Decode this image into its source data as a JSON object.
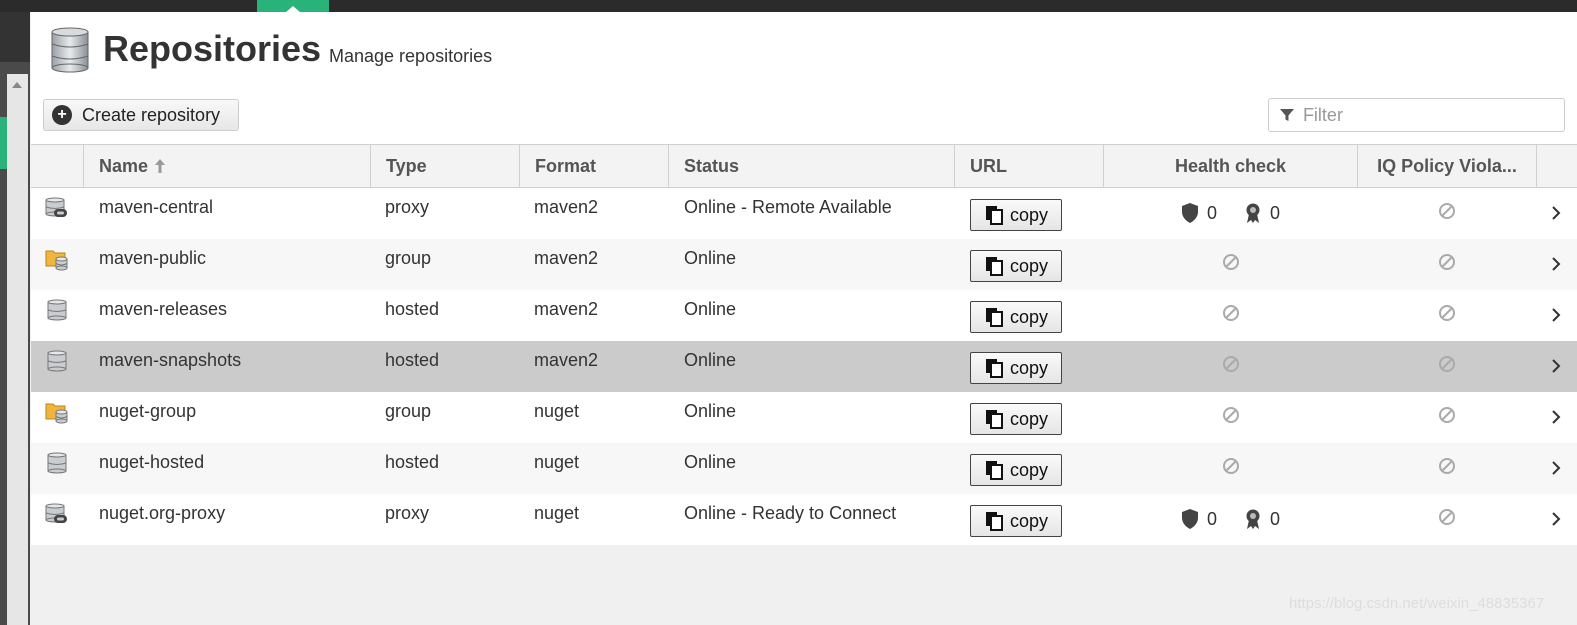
{
  "header": {
    "title": "Repositories",
    "subtitle": "Manage repositories"
  },
  "toolbar": {
    "create_label": "Create repository",
    "filter_placeholder": "Filter"
  },
  "table": {
    "columns": {
      "name": "Name",
      "type": "Type",
      "format": "Format",
      "status": "Status",
      "url": "URL",
      "health": "Health check",
      "iq": "IQ Policy Viola..."
    },
    "copy_label": "copy",
    "rows": [
      {
        "name": "maven-central",
        "type": "proxy",
        "format": "maven2",
        "status": "Online - Remote Available",
        "kind": "proxy",
        "health_security": "0",
        "health_license": "0"
      },
      {
        "name": "maven-public",
        "type": "group",
        "format": "maven2",
        "status": "Online",
        "kind": "group"
      },
      {
        "name": "maven-releases",
        "type": "hosted",
        "format": "maven2",
        "status": "Online",
        "kind": "hosted"
      },
      {
        "name": "maven-snapshots",
        "type": "hosted",
        "format": "maven2",
        "status": "Online",
        "kind": "hosted",
        "selected": true
      },
      {
        "name": "nuget-group",
        "type": "group",
        "format": "nuget",
        "status": "Online",
        "kind": "group"
      },
      {
        "name": "nuget-hosted",
        "type": "hosted",
        "format": "nuget",
        "status": "Online",
        "kind": "hosted"
      },
      {
        "name": "nuget.org-proxy",
        "type": "proxy",
        "format": "nuget",
        "status": "Online - Ready to Connect",
        "kind": "proxy",
        "health_security": "0",
        "health_license": "0"
      }
    ]
  },
  "watermark": "https://blog.csdn.net/weixin_48835367",
  "colors": {
    "accent": "#2ab27b",
    "selected_row": "#cbcbcb"
  }
}
